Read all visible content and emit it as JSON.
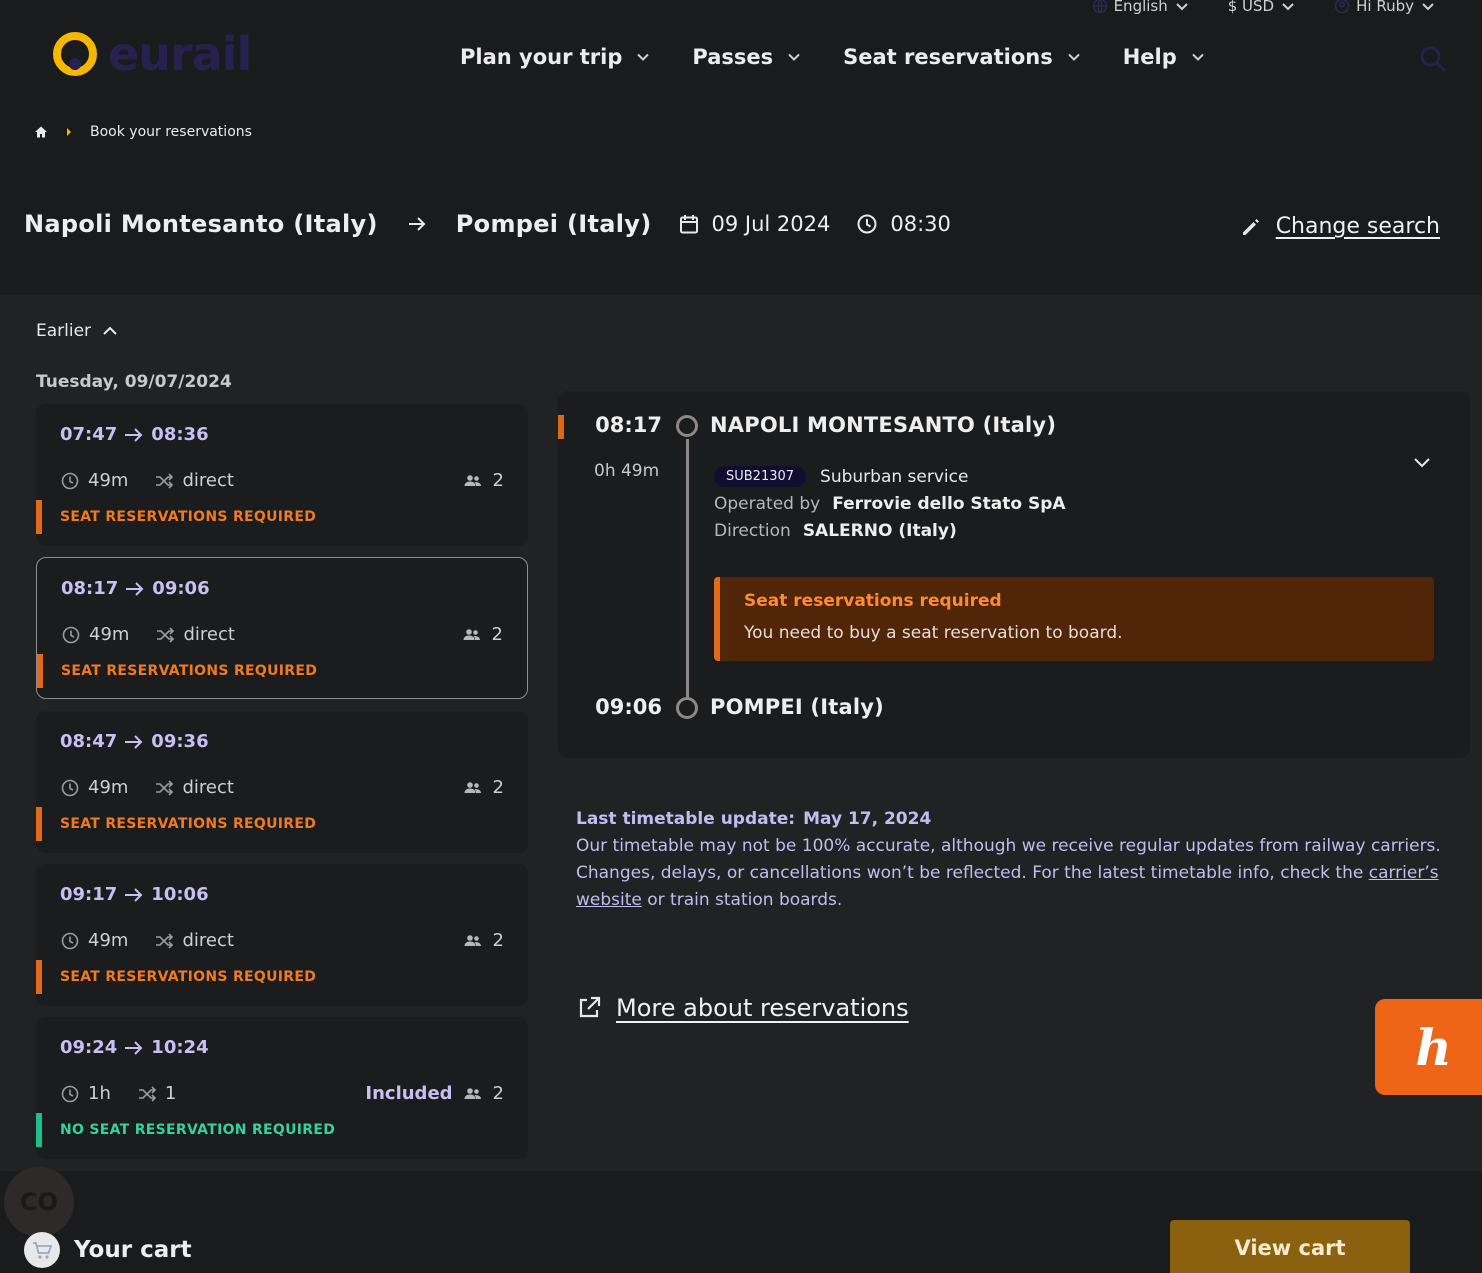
{
  "topbar": {
    "language": "English",
    "currency": "$ USD",
    "greeting": "Hi Ruby"
  },
  "logo": {
    "text": "eurail",
    "accent_color": "#f5b800"
  },
  "nav": [
    {
      "label": "Plan your trip"
    },
    {
      "label": "Passes"
    },
    {
      "label": "Seat reservations"
    },
    {
      "label": "Help"
    }
  ],
  "breadcrumb": {
    "current": "Book your reservations"
  },
  "search": {
    "origin": "Napoli Montesanto (Italy)",
    "destination": "Pompei (Italy)",
    "date": "09 Jul 2024",
    "time": "08:30",
    "change_label": "Change search"
  },
  "results": {
    "earlier_label": "Earlier",
    "date_heading": "Tuesday, 09/07/2024",
    "journeys": [
      {
        "depart": "07:47",
        "arrive": "08:36",
        "duration": "49m",
        "changes": "direct",
        "included": "",
        "passengers": "2",
        "badge": "SEAT RESERVATIONS REQUIRED",
        "badge_type": "required",
        "selected": false
      },
      {
        "depart": "08:17",
        "arrive": "09:06",
        "duration": "49m",
        "changes": "direct",
        "included": "",
        "passengers": "2",
        "badge": "SEAT RESERVATIONS REQUIRED",
        "badge_type": "required",
        "selected": true
      },
      {
        "depart": "08:47",
        "arrive": "09:36",
        "duration": "49m",
        "changes": "direct",
        "included": "",
        "passengers": "2",
        "badge": "SEAT RESERVATIONS REQUIRED",
        "badge_type": "required",
        "selected": false
      },
      {
        "depart": "09:17",
        "arrive": "10:06",
        "duration": "49m",
        "changes": "direct",
        "included": "",
        "passengers": "2",
        "badge": "SEAT RESERVATIONS REQUIRED",
        "badge_type": "required",
        "selected": false
      },
      {
        "depart": "09:24",
        "arrive": "10:24",
        "duration": "1h",
        "changes": "1",
        "included": "Included",
        "passengers": "2",
        "badge": "NO SEAT RESERVATION REQUIRED",
        "badge_type": "none",
        "selected": false
      }
    ]
  },
  "detail": {
    "depart_time": "08:17",
    "depart_station": "NAPOLI MONTESANTO (Italy)",
    "duration": "0h 49m",
    "train_code": "SUB21307",
    "service": "Suburban service",
    "operated_label": "Operated by",
    "operator": "Ferrovie dello Stato SpA",
    "direction_label": "Direction",
    "direction": "SALERNO (Italy)",
    "alert_title": "Seat reservations required",
    "alert_text": "You need to buy a seat reservation to board.",
    "arrive_time": "09:06",
    "arrive_station": "POMPEI (Italy)"
  },
  "timetable": {
    "update_label": "Last timetable update:",
    "update_date": "May 17, 2024",
    "text_before": "Our timetable may not be 100% accurate, although we receive regular updates from railway carriers. Changes, delays, or cancellations won’t be reflected. For the latest timetable info, check the ",
    "link": "carrier’s website",
    "text_after": " or train station boards."
  },
  "more_about": "More about reservations",
  "honey_letter": "h",
  "co_badge": "CO",
  "cart": {
    "label": "Your cart",
    "button": "View cart"
  }
}
